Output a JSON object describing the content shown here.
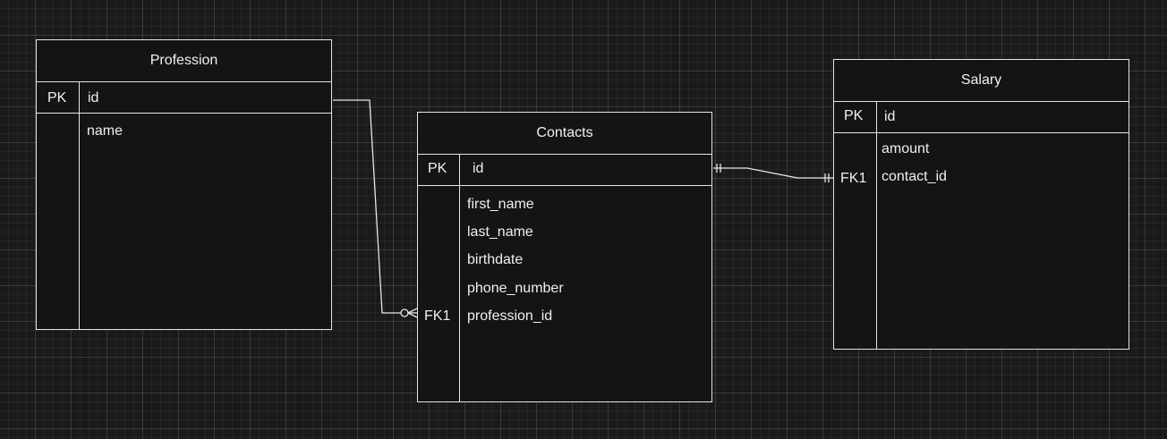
{
  "entities": {
    "profession": {
      "title": "Profession",
      "pk_label": "PK",
      "pk_field": "id",
      "fields": [
        "name"
      ]
    },
    "contacts": {
      "title": "Contacts",
      "pk_label": "PK",
      "pk_field": "id",
      "fields": [
        "first_name",
        "last_name",
        "birthdate",
        "phone_number",
        "profession_id"
      ],
      "fk_label": "FK1"
    },
    "salary": {
      "title": "Salary",
      "pk_label": "PK",
      "pk_field": "id",
      "fields": [
        "amount",
        "contact_id"
      ],
      "fk_label": "FK1"
    }
  },
  "relationships": [
    {
      "from": "Profession.id",
      "to": "Contacts.profession_id",
      "from_end": "none",
      "to_end": "zero-or-many"
    },
    {
      "from": "Contacts.id",
      "to": "Salary.contact_id",
      "from_end": "one-and-only-one",
      "to_end": "one-and-only-one"
    }
  ],
  "colors": {
    "background": "#1a1a1a",
    "entity_fill": "#141414",
    "stroke": "#e6e6e6",
    "text": "#f0f0f0"
  }
}
